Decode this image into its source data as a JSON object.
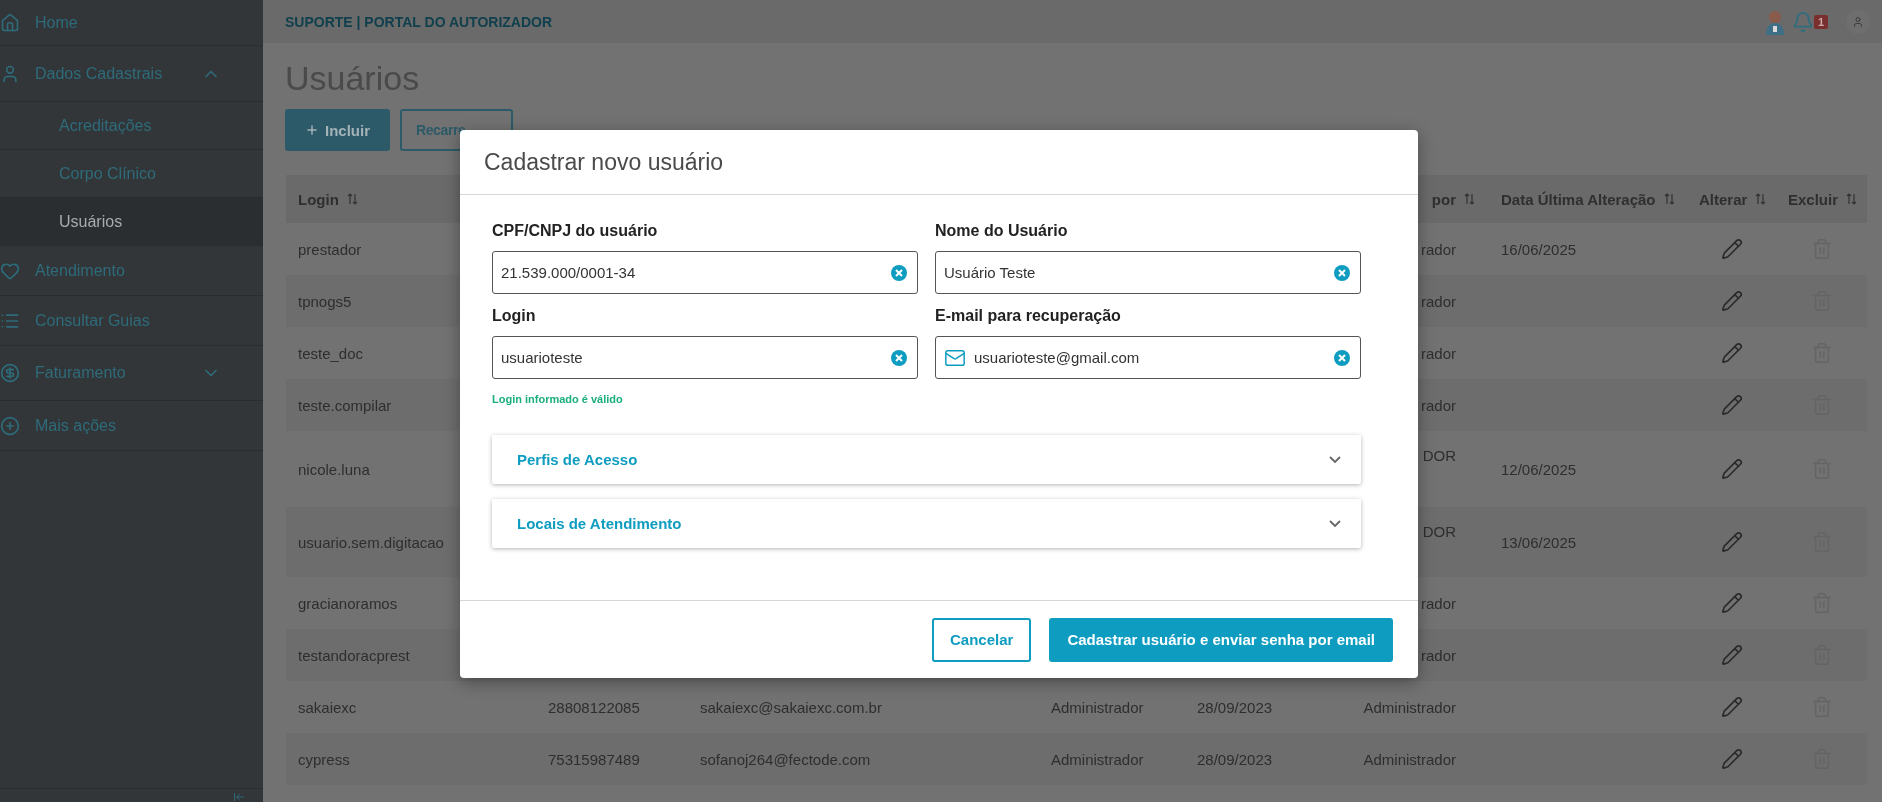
{
  "sidebar": {
    "items": [
      {
        "label": "Home",
        "selected": false
      },
      {
        "label": "Dados Cadastrais",
        "selected": false,
        "expanded": true,
        "children": [
          {
            "label": "Acreditações",
            "selected": false
          },
          {
            "label": "Corpo Clínico",
            "selected": false
          },
          {
            "label": "Usuários",
            "selected": true
          }
        ]
      },
      {
        "label": "Atendimento",
        "selected": false
      },
      {
        "label": "Consultar Guias",
        "selected": false
      },
      {
        "label": "Faturamento",
        "selected": false,
        "expanded": false
      },
      {
        "label": "Mais ações",
        "selected": false
      }
    ]
  },
  "header": {
    "title": "SUPORTE | PORTAL DO AUTORIZADOR",
    "notification_count": "1"
  },
  "page": {
    "title": "Usuários",
    "buttons": [
      {
        "label": "Incluir",
        "kind": "primary"
      },
      {
        "label": "Recarre",
        "kind": "outline"
      }
    ]
  },
  "table": {
    "columns": [
      {
        "label": "Login",
        "sortable": true
      },
      {
        "label": "por",
        "sortable": true
      },
      {
        "label": "Data Última Alteração",
        "sortable": true
      },
      {
        "label": "Alterar",
        "sortable": true
      },
      {
        "label": "Excluir",
        "sortable": true
      }
    ],
    "rows": [
      {
        "kind": "single",
        "login": "prestador",
        "column_6": "rador",
        "data_ultima_alteracao": "16/06/2025",
        "delete_disabled": true
      },
      {
        "kind": "single",
        "login": "tpnogs5",
        "column_6": "rador",
        "delete_disabled": true
      },
      {
        "kind": "single",
        "login": "teste_doc",
        "column_6": "rador",
        "delete_disabled": true
      },
      {
        "kind": "single",
        "login": "teste.compilar",
        "column_6": "rador",
        "delete_disabled": true
      },
      {
        "kind": "double",
        "login": "nicole.luna",
        "column_6": "DOR",
        "data_ultima_alteracao": "12/06/2025",
        "delete_disabled": true
      },
      {
        "kind": "double",
        "login": "usuario.sem.digitacao",
        "column_6": "DOR",
        "data_ultima_alteracao": "13/06/2025",
        "delete_disabled": true
      },
      {
        "kind": "single",
        "login": "gracianoramos",
        "column_6": "rador",
        "delete_disabled": true
      },
      {
        "kind": "single",
        "login": "testandoracprest",
        "column_6": "rador",
        "delete_disabled": true
      },
      {
        "kind": "single",
        "login": "sakaiexc",
        "column_2": "28808122085",
        "column_3": "sakaiexc@sakaiexc.com.br",
        "column_4": "Administrador",
        "column_5": "28/09/2023",
        "column_6": "Administrador",
        "delete_disabled": true
      },
      {
        "kind": "single",
        "login": "cypress",
        "column_2": "75315987489",
        "column_3": "sofanoj264@fectode.com",
        "column_4": "Administrador",
        "column_5": "28/09/2023",
        "column_6": "Administrador",
        "delete_disabled": true
      }
    ]
  },
  "modal": {
    "title": "Cadastrar novo usuário",
    "fields": [
      {
        "label": "CPF/CNPJ do usuário",
        "value": "21.539.000/0001-34",
        "kind": "text"
      },
      {
        "label": "Nome do Usuário",
        "value": "Usuário Teste",
        "kind": "text"
      },
      {
        "label": "Login",
        "value": "usuarioteste",
        "kind": "text",
        "hint": "Login informado é válido"
      },
      {
        "label": "E-mail para recuperação",
        "value": "usuarioteste@gmail.com",
        "kind": "email"
      }
    ],
    "accordions": [
      {
        "label": "Perfis de Acesso",
        "expanded": false
      },
      {
        "label": "Locais de Atendimento",
        "expanded": false
      }
    ],
    "buttons": [
      {
        "label": "Cancelar",
        "kind": "outline"
      },
      {
        "label": "Cadastrar usuário e enviar senha por email",
        "kind": "primary"
      }
    ]
  }
}
